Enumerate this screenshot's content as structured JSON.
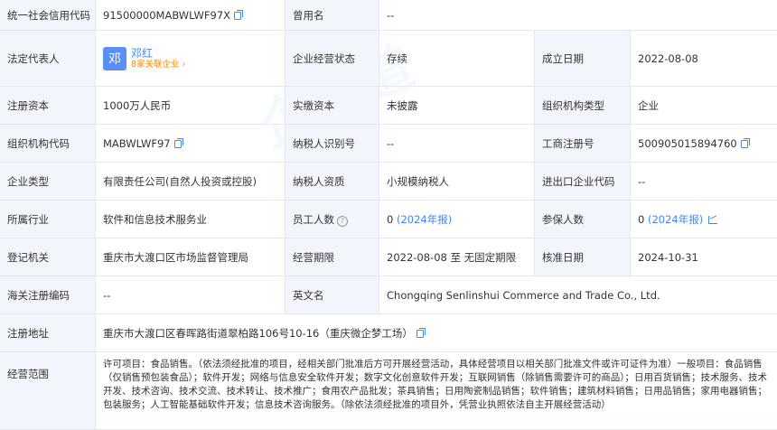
{
  "rows": {
    "credit_code": {
      "label": "统一社会信用代码",
      "value": "91500000MABWLWF97X"
    },
    "former_name": {
      "label": "曾用名",
      "value": "--"
    },
    "legal_rep": {
      "label": "法定代表人",
      "avatar": "邓",
      "name": "邓红",
      "related": "8家关联企业"
    },
    "status": {
      "label": "企业经营状态",
      "value": "存续"
    },
    "founded": {
      "label": "成立日期",
      "value": "2022-08-08"
    },
    "reg_capital": {
      "label": "注册资本",
      "value": "1000万人民币"
    },
    "paid_capital": {
      "label": "实缴资本",
      "value": "未披露"
    },
    "org_type": {
      "label": "组织机构类型",
      "value": "企业"
    },
    "org_code": {
      "label": "组织机构代码",
      "value": "MABWLWF97"
    },
    "taxpayer_id": {
      "label": "纳税人识别号",
      "value": "--"
    },
    "biz_reg_no": {
      "label": "工商注册号",
      "value": "500905015894760"
    },
    "company_type": {
      "label": "企业类型",
      "value": "有限责任公司(自然人投资或控股)"
    },
    "taxpayer_qual": {
      "label": "纳税人资质",
      "value": "小规模纳税人"
    },
    "import_export": {
      "label": "进出口企业代码",
      "value": "--"
    },
    "industry": {
      "label": "所属行业",
      "value": "软件和信息技术服务业"
    },
    "employees": {
      "label": "员工人数",
      "value": "0",
      "report": "(2024年报)"
    },
    "insured": {
      "label": "参保人数",
      "value": "0",
      "report": "(2024年报)"
    },
    "reg_authority": {
      "label": "登记机关",
      "value": "重庆市大渡口区市场监督管理局"
    },
    "term": {
      "label": "经营期限",
      "value": "2022-08-08 至 无固定期限"
    },
    "approval_date": {
      "label": "核准日期",
      "value": "2024-10-31"
    },
    "customs_code": {
      "label": "海关注册编码",
      "value": "--"
    },
    "english_name": {
      "label": "英文名",
      "value": "Chongqing Senlinshui Commerce and Trade Co., Ltd."
    },
    "address": {
      "label": "注册地址",
      "value": "重庆市大渡口区春晖路街道翠柏路106号10-16（重庆微企梦工场）"
    },
    "scope": {
      "label": "经营范围",
      "value": "许可项目：食品销售。（依法须经批准的项目，经相关部门批准后方可开展经营活动，具体经营项目以相关部门批准文件或许可证件为准）一般项目：食品销售（仅销售预包装食品）；软件开发；网络与信息安全软件开发；数字文化创意软件开发；互联网销售（除销售需要许可的商品）；日用百货销售；技术服务、技术开发、技术咨询、技术交流、技术转让、技术推广；食用农产品批发；茶具销售；日用陶瓷制品销售；软件销售；建筑材料销售；日用品销售；家用电器销售；包装服务；人工智能基础软件开发；信息技术咨询服务。（除依法须经批准的项目外，凭营业执照依法自主开展经营活动）"
    }
  },
  "watermark": "企知道"
}
